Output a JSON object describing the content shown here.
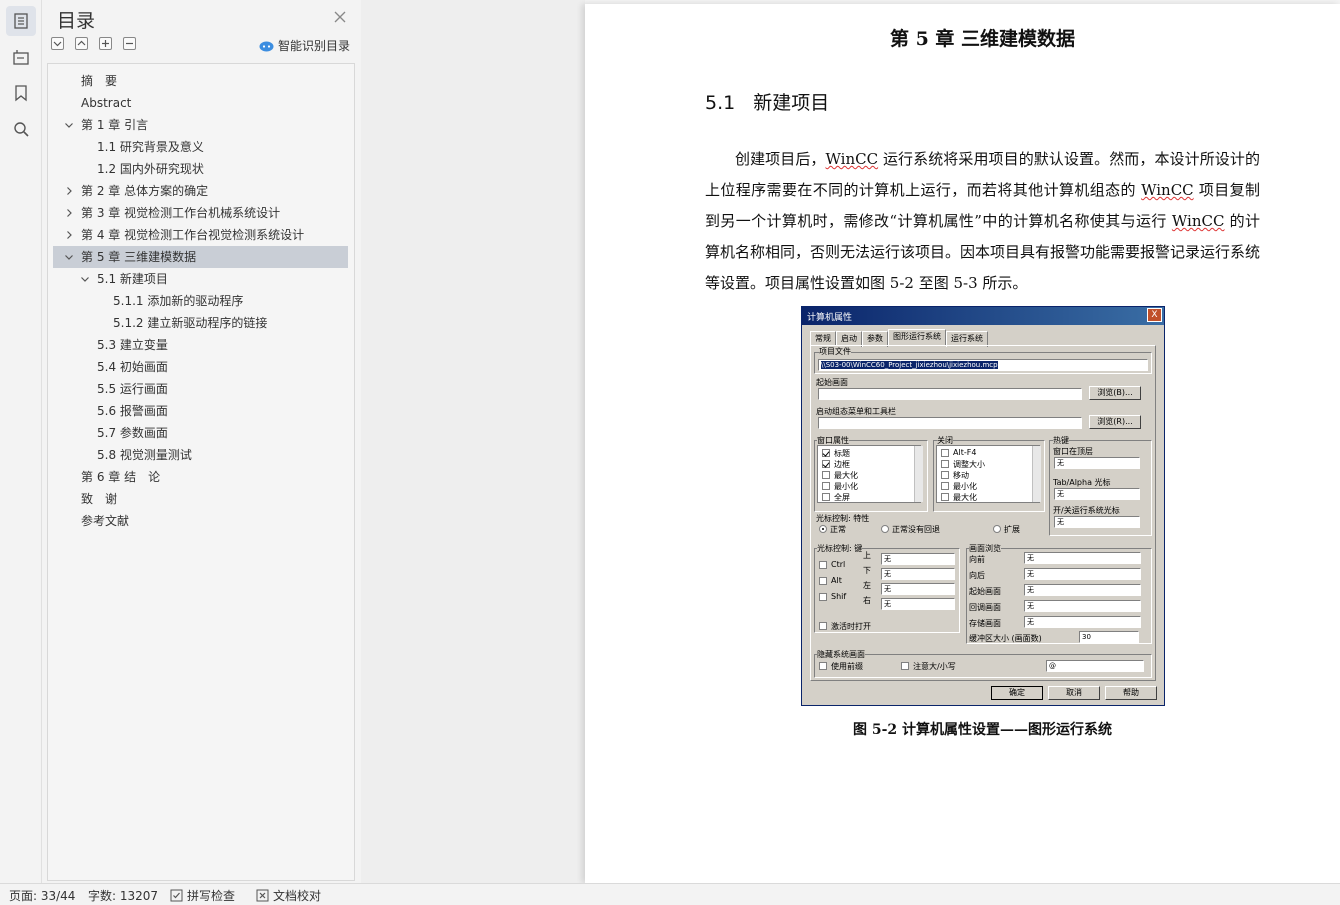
{
  "rail": {
    "icons": [
      "toc-icon",
      "structure-icon",
      "bookmark-icon",
      "search-icon"
    ]
  },
  "toc": {
    "title": "目录",
    "smart_label": "智能识别目录",
    "items": [
      {
        "label": "摘　要",
        "level": 1,
        "chev": "none",
        "selected": false
      },
      {
        "label": "Abstract",
        "level": 1,
        "chev": "none",
        "selected": false
      },
      {
        "label": "第 1 章  引言",
        "level": 1,
        "chev": "down",
        "selected": false
      },
      {
        "label": "1.1 研究背景及意义",
        "level": 2,
        "chev": "none",
        "selected": false
      },
      {
        "label": "1.2 国内外研究现状",
        "level": 2,
        "chev": "none",
        "selected": false
      },
      {
        "label": "第 2 章  总体方案的确定",
        "level": 1,
        "chev": "right",
        "selected": false
      },
      {
        "label": "第 3 章  视觉检测工作台机械系统设计",
        "level": 1,
        "chev": "right",
        "selected": false
      },
      {
        "label": "第 4 章  视觉检测工作台视觉检测系统设计",
        "level": 1,
        "chev": "right",
        "selected": false
      },
      {
        "label": "第 5 章  三维建模数据",
        "level": 1,
        "chev": "down",
        "selected": true
      },
      {
        "label": "5.1    新建项目",
        "level": 2,
        "chev": "down",
        "selected": false
      },
      {
        "label": "5.1.1  添加新的驱动程序",
        "level": 3,
        "chev": "none",
        "selected": false
      },
      {
        "label": "5.1.2  建立新驱动程序的链接",
        "level": 3,
        "chev": "none",
        "selected": false
      },
      {
        "label": "5.3    建立变量",
        "level": 2,
        "chev": "none",
        "selected": false
      },
      {
        "label": "5.4    初始画面",
        "level": 2,
        "chev": "none",
        "selected": false
      },
      {
        "label": "5.5    运行画面",
        "level": 2,
        "chev": "none",
        "selected": false
      },
      {
        "label": "5.6    报警画面",
        "level": 2,
        "chev": "none",
        "selected": false
      },
      {
        "label": "5.7    参数画面",
        "level": 2,
        "chev": "none",
        "selected": false
      },
      {
        "label": "5.8    视觉测量测试",
        "level": 2,
        "chev": "none",
        "selected": false
      },
      {
        "label": "第 6 章 结　论",
        "level": 1,
        "chev": "none",
        "selected": false
      },
      {
        "label": "致　谢",
        "level": 1,
        "chev": "none",
        "selected": false
      },
      {
        "label": "参考文献",
        "level": 1,
        "chev": "none",
        "selected": false
      }
    ]
  },
  "doc": {
    "chapter": "第 5 章  三维建模数据",
    "section_num": "5.1",
    "section_title": "新建项目",
    "para_parts": [
      {
        "t": "创建项目后，",
        "w": false
      },
      {
        "t": "WinCC",
        "w": true
      },
      {
        "t": " 运行系统将采用项目的默认设置。然而，本设计所设计的上位程序需要在不同的计算机上运行，而若将其他计算机组态的 ",
        "w": false
      },
      {
        "t": "WinCC",
        "w": true
      },
      {
        "t": " 项目复制到另一个计算机时，需修改“计算机属性”中的计算机名称使其与运行 ",
        "w": false
      },
      {
        "t": "WinCC",
        "w": true
      },
      {
        "t": " 的计算机名称相同，否则无法运行该项目。因本项目具有报警功能需要报警记录运行系统等设置。项目属性设置如图 5-2 至图 5-3 所示。",
        "w": false
      }
    ],
    "caption": "图 5-2  计算机属性设置——图形运行系统"
  },
  "dialog": {
    "title": "计算机属性",
    "close": "X",
    "tabs": [
      "常规",
      "启动",
      "参数",
      "图形运行系统",
      "运行系统"
    ],
    "project_file_label": "项目文件",
    "project_file_value": "\\\\S03-00\\WinCC60_Project_jixiezhou\\jixiezhou.mcp",
    "start_screen_label": "起始画面",
    "browse1": "浏览(B)...",
    "start_menu_label": "启动组态菜单和工具栏",
    "browse2": "浏览(R)...",
    "window_attr_label": "窗口属性",
    "window_attr_items": [
      {
        "label": "标题",
        "checked": true
      },
      {
        "label": "边框",
        "checked": true
      },
      {
        "label": "最大化",
        "checked": false
      },
      {
        "label": "最小化",
        "checked": false
      },
      {
        "label": "全屏",
        "checked": false
      }
    ],
    "close_group_label": "关闭",
    "close_items": [
      {
        "label": "Alt-F4",
        "checked": false
      },
      {
        "label": "调整大小",
        "checked": false
      },
      {
        "label": "移动",
        "checked": false
      },
      {
        "label": "最小化",
        "checked": false
      },
      {
        "label": "最大化",
        "checked": false
      }
    ],
    "hotkey_label": "热键",
    "window_top_label": "窗口在顶层",
    "window_top_value": "无",
    "tab_alpha_label": "Tab/Alpha 光标",
    "tab_alpha_value": "无",
    "cursor_toggle_label": "开/关运行系统光标",
    "cursor_toggle_value": "无",
    "cursor_ctrl_label": "光标控制: 特性",
    "cursor_opts": [
      "正常",
      "正常没有回退",
      "扩展"
    ],
    "cursor_key_label": "光标控制: 键",
    "mod_keys": [
      "Ctrl",
      "Alt",
      "Shif"
    ],
    "dir_labels": [
      "上",
      "下",
      "左",
      "右"
    ],
    "dir_values": [
      "无",
      "无",
      "无",
      "无"
    ],
    "expect_open": "激活时打开",
    "screen_browse_label": "画面浏览",
    "screen_rows": [
      {
        "label": "向前",
        "value": "无"
      },
      {
        "label": "向后",
        "value": "无"
      },
      {
        "label": "起始画面",
        "value": "无"
      },
      {
        "label": "回调画面",
        "value": "无"
      },
      {
        "label": "存储画面",
        "value": "无"
      }
    ],
    "buffer_label": "缓冲区大小 (画面数)",
    "buffer_value": "30",
    "hide_sys_label": "隐藏系统画面",
    "use_prefix": "使用前缀",
    "case_label": "注意大/小写",
    "prefix_value": "@",
    "ok": "确定",
    "cancel": "取消",
    "help": "帮助"
  },
  "status": {
    "page": "页面: 33/44",
    "words": "字数: 13207",
    "spell": "拼写检查",
    "proof": "文档校对"
  }
}
